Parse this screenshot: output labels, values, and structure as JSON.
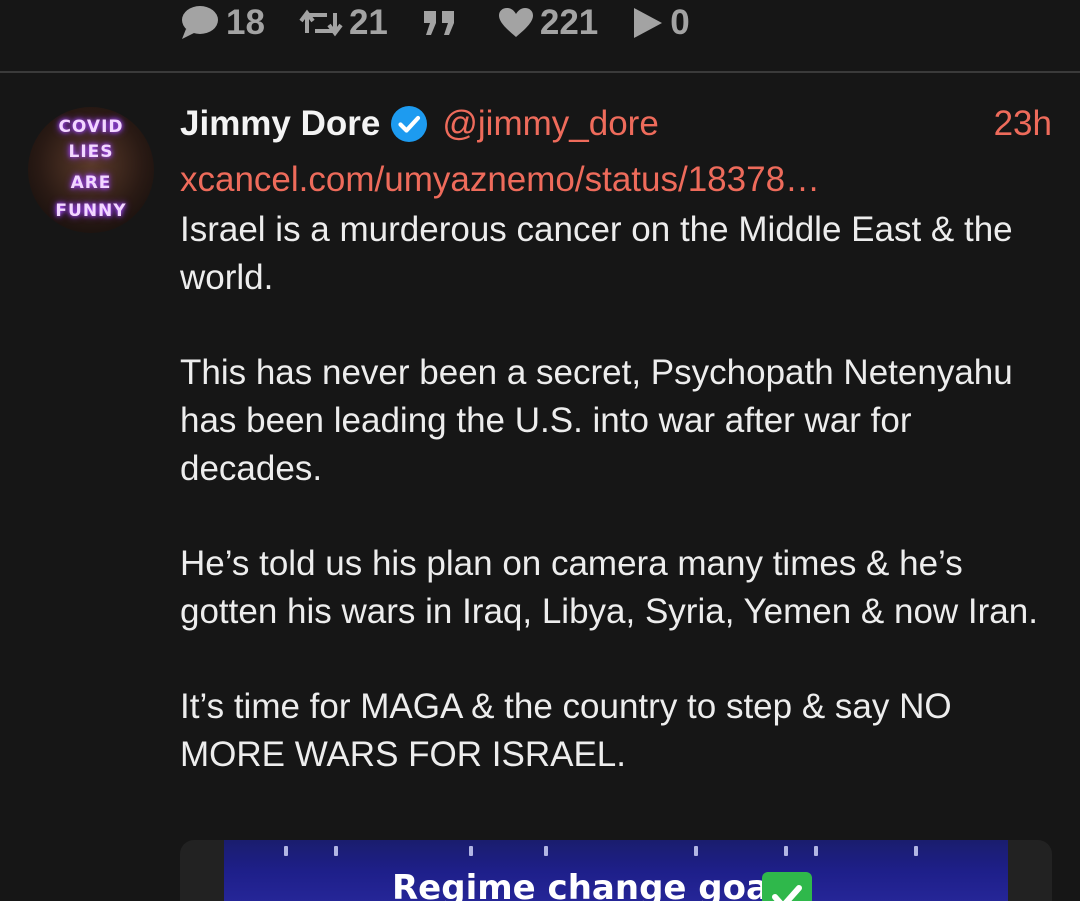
{
  "previous_tweet": {
    "stats": {
      "replies": "18",
      "retweets": "21",
      "quotes": "",
      "likes": "221",
      "views": "0"
    }
  },
  "tweet": {
    "avatar": {
      "lines": [
        "COVID",
        "LIES",
        "ARE",
        "FUNNY"
      ]
    },
    "author_name": "Jimmy Dore",
    "handle": "@jimmy_dore",
    "timestamp": "23h",
    "link": "xcancel.com/umyaznemo/status/18378…",
    "paragraphs": [
      "Israel is a murderous cancer on the Middle East & the world.",
      "This has never been a secret, Psychopath Netenyahu has been leading the U.S. into war after war for decades.",
      "He’s told us his plan on camera many times & he’s gotten his wars in Iraq, Libya, Syria, Yemen & now Iran.",
      "It’s time for MAGA & the country to step & say NO MORE WARS FOR ISRAEL."
    ],
    "media": {
      "caption": "Regime change goals"
    }
  },
  "colors": {
    "background": "#161616",
    "accent": "#ee6b5b",
    "muted": "#a3a3a3",
    "verified": "#1d9bf0"
  },
  "icons": {
    "replies": "comment-icon",
    "retweets": "retweet-icon",
    "quotes": "quote-icon",
    "likes": "heart-icon",
    "views": "play-icon",
    "verified": "verified-badge-icon"
  }
}
